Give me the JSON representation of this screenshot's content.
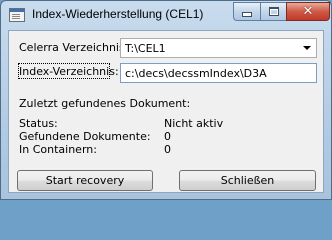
{
  "window": {
    "title": "Index-Wiederherstellung (CEL1)",
    "close_glyph": "✕"
  },
  "form": {
    "celerra_label": "Celerra Verzeichnis:",
    "celerra_value": "T:\\CEL1",
    "index_label": "Index-Verzeichnis:",
    "index_value": "c:\\decs\\decssmIndex\\D3A"
  },
  "status": {
    "last_doc_label": "Zuletzt gefundenes Dokument:",
    "rows": [
      {
        "label": "Status:",
        "value": "Nicht aktiv"
      },
      {
        "label": "Gefundene Dokumente:",
        "value": "0"
      },
      {
        "label": "In Containern:",
        "value": "0"
      }
    ]
  },
  "buttons": {
    "start": "Start recovery",
    "close": "Schließen"
  }
}
